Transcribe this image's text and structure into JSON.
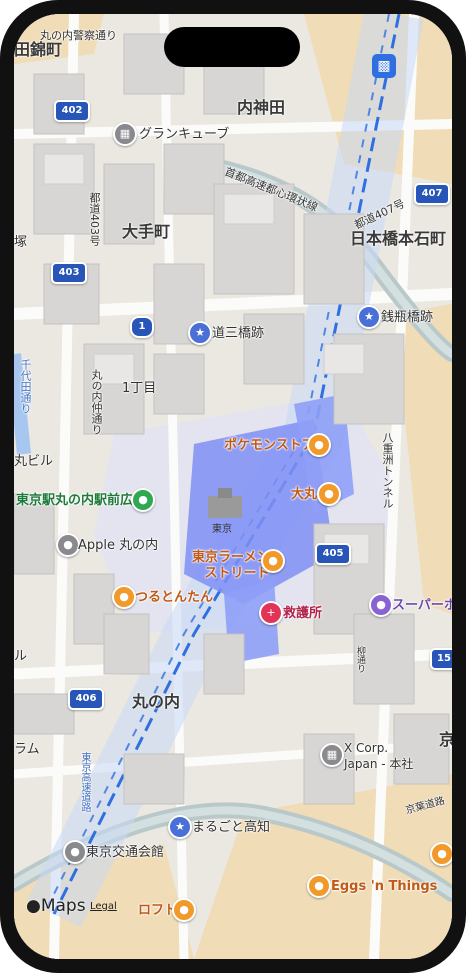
{
  "map": {
    "areas": [
      "内神田",
      "大手町",
      "日本橋本石町",
      "丸の内",
      "1丁目"
    ],
    "roads": [
      "首都高速都心環状線",
      "都道407号",
      "都道403号",
      "八重洲トンネル",
      "丸の内仲通り",
      "京葉道路",
      "千代田通り",
      "柳通り",
      "東京高速道路",
      "丸の内警察通り"
    ],
    "partial_labels": [
      "田錦町",
      "塚",
      "丸ビル",
      "ラム",
      "ル",
      "京"
    ],
    "station_name": "東京",
    "shields": [
      "402",
      "407",
      "403",
      "1",
      "405",
      "406",
      "15"
    ]
  },
  "pois": [
    {
      "name": "グランキューブ",
      "icon": "building-icon",
      "color": "#8a8a8e"
    },
    {
      "name": "銭瓶橋跡",
      "icon": "star-icon",
      "color": "#4a6fd6"
    },
    {
      "name": "道三橋跡",
      "icon": "star-icon",
      "color": "#4a6fd6"
    },
    {
      "name": "ポケモンストア",
      "icon": "bag-icon",
      "color": "#f19a2a"
    },
    {
      "name": "大丸",
      "icon": "bag-icon",
      "color": "#f19a2a"
    },
    {
      "name": "東京駅丸の内駅前広場",
      "icon": "park-icon",
      "color": "#2fa84f"
    },
    {
      "name": "Apple 丸の内",
      "icon": "apple-icon",
      "color": "#8a8a8e"
    },
    {
      "name": "東京ラーメン\nストリート",
      "icon": "food-icon",
      "color": "#f19a2a"
    },
    {
      "name": "救護所",
      "icon": "medical-icon",
      "color": "#e23457"
    },
    {
      "name": "スーパーホ",
      "icon": "bed-icon",
      "color": "#8a63d2"
    },
    {
      "name": "つるとんたん",
      "icon": "food-icon",
      "color": "#f19a2a"
    },
    {
      "name": "X Corp.\nJapan - 本社",
      "icon": "building-icon",
      "color": "#8a8a8e"
    },
    {
      "name": "まるごと高知",
      "icon": "star-icon",
      "color": "#4a6fd6"
    },
    {
      "name": "東京交通会館",
      "icon": "dot-icon",
      "color": "#8a8a8e"
    },
    {
      "name": "Eggs 'n Things",
      "icon": "food-icon",
      "color": "#f19a2a"
    },
    {
      "name": "ロフト",
      "icon": "bag-icon",
      "color": "#f19a2a"
    }
  ],
  "footer": {
    "brand": "Maps",
    "legal": "Legal"
  }
}
